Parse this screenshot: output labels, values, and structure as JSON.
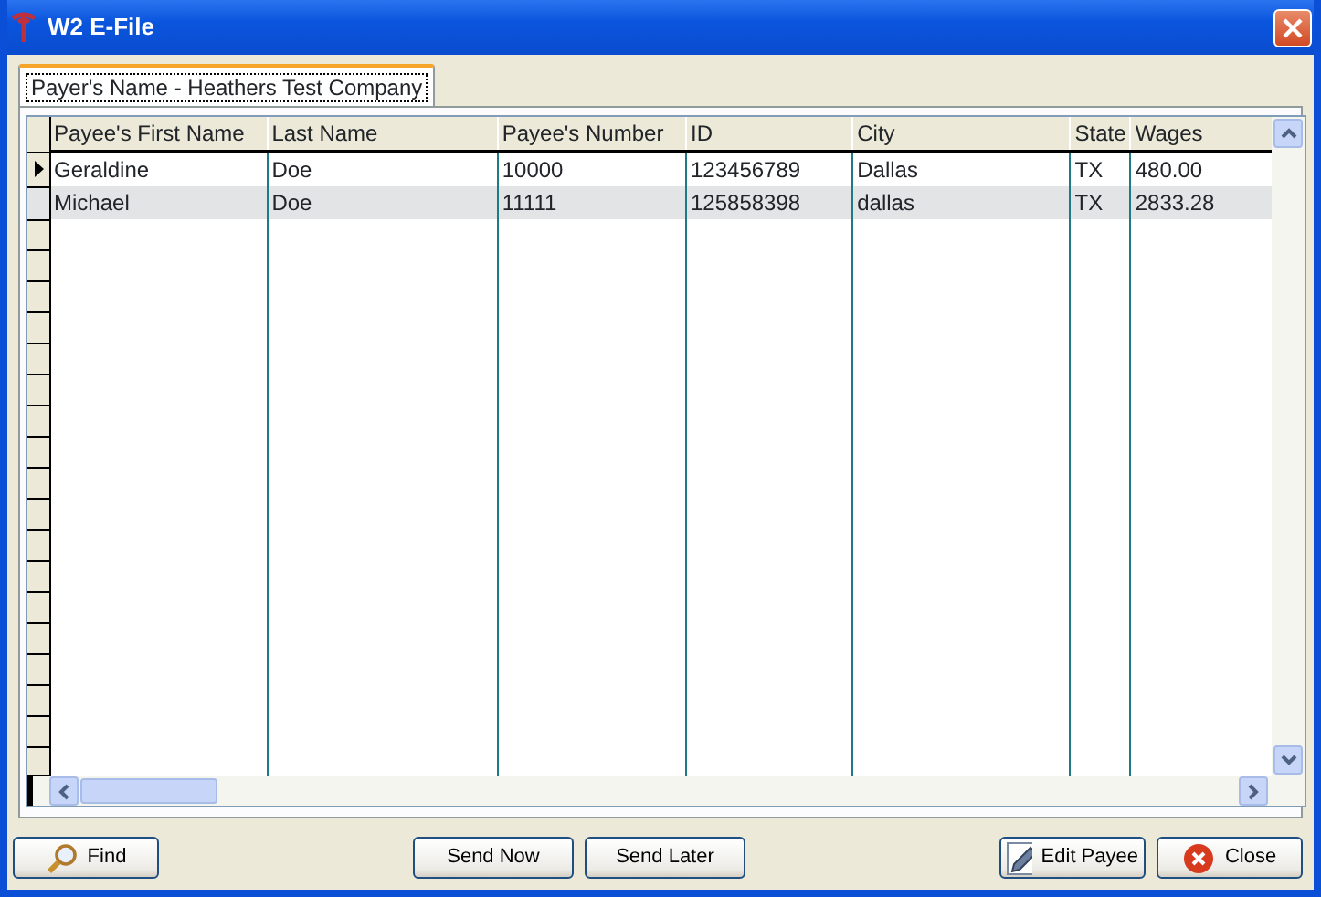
{
  "window": {
    "title": "W2 E-File"
  },
  "tabs": [
    {
      "label": "Payer's Name - Heathers Test Company",
      "selected": true
    }
  ],
  "table": {
    "columns": [
      "Payee's First Name",
      "Last Name",
      "Payee's Number",
      "ID",
      "City",
      "State",
      "Wages"
    ],
    "rows": [
      {
        "current": true,
        "cells": [
          "Geraldine",
          "Doe",
          "10000",
          "123456789",
          "Dallas",
          "TX",
          "480.00"
        ]
      },
      {
        "current": false,
        "cells": [
          "Michael",
          "Doe",
          "11111",
          "125858398",
          "dallas",
          "TX",
          "2833.28"
        ]
      }
    ]
  },
  "buttons": [
    {
      "kind": "find",
      "label": "Find"
    },
    {
      "kind": "plain",
      "label": "Send Now"
    },
    {
      "kind": "plain",
      "label": "Send Later"
    },
    {
      "kind": "edit",
      "label": "Edit Payee"
    },
    {
      "kind": "close",
      "label": "Close"
    }
  ]
}
